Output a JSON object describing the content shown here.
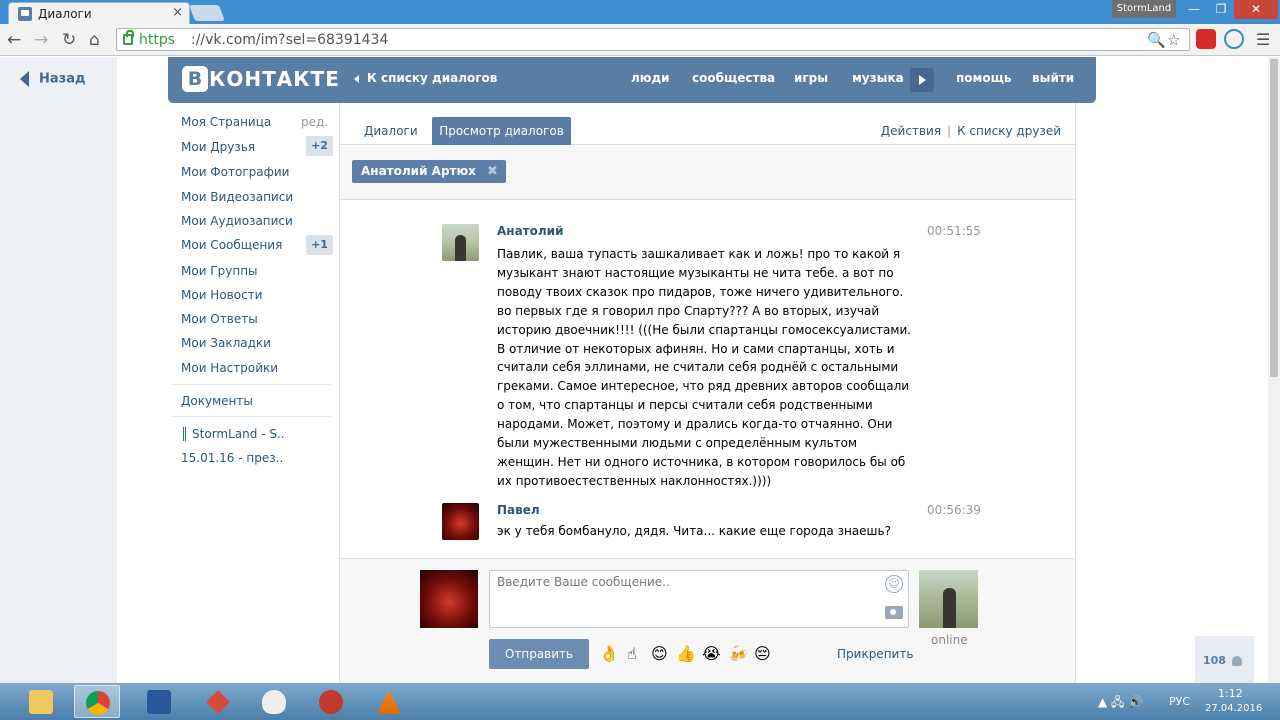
{
  "browser": {
    "tab_title": "Диалоги",
    "tab_close": "×",
    "profile_name": "StormLand",
    "url_https": "https",
    "url_rest": "://vk.com/im?sel=68391434",
    "window_controls": {
      "minimize": "—",
      "maximize": "❐",
      "close": "✕"
    }
  },
  "page": {
    "back_label": "Назад",
    "logo_b": "В",
    "logo_text": "КОНТАКТЕ",
    "header": {
      "back_to_dialogs": "К списку диалогов",
      "links": [
        "люди",
        "сообщества",
        "игры",
        "музыка",
        "помощь",
        "выйти"
      ]
    },
    "sidebar": {
      "items": [
        {
          "label": "Моя Страница",
          "extra": "ред."
        },
        {
          "label": "Мои Друзья",
          "badge": "+2"
        },
        {
          "label": "Мои Фотографии"
        },
        {
          "label": "Мои Видеозаписи"
        },
        {
          "label": "Мои Аудиозаписи"
        },
        {
          "label": "Мои Сообщения",
          "badge": "+1"
        },
        {
          "label": "Мои Группы"
        },
        {
          "label": "Мои Новости"
        },
        {
          "label": "Мои Ответы"
        },
        {
          "label": "Мои Закладки"
        },
        {
          "label": "Мои Настройки"
        }
      ],
      "documents": "Документы",
      "extra_links": [
        "║ StormLand - S..",
        "15.01.16 - през.."
      ]
    },
    "tabs": {
      "dialogs": "Диалоги",
      "view": "Просмотр диалогов",
      "actions": "Действия",
      "separator": "|",
      "friends": "К списку друзей"
    },
    "peer_chip": {
      "name": "Анатолий Артюх",
      "remove": "✖"
    },
    "messages": [
      {
        "author": "Анатолий",
        "time": "00:51:55",
        "text": "Павлик, ваша тупасть зашкаливает как и ложь! про то какой я музыкант знают настоящие музыканты не чита тебе. а вот по поводу твоих сказок про пидаров, тоже ничего удивительного. во первых где я говорил про Спарту??? А во вторых, изучай историю двоечник!!!! (((Не были спартанцы гомосексуалистами. В отличие от некоторых афинян. Но и сами спартанцы, хоть и считали себя эллинами, не считали себя роднёй с остальными греками. Самое интересное, что ряд древних авторов сообщали о том, что спартанцы и персы считали себя родственными народами. Может, поэтому и дрались когда-то отчаянно. Они были мужественными людьми с определённым культом женщин. Нет ни одного источника, в котором говорилось бы об их противоестественных наклонностях.))))"
      },
      {
        "author": "Павел",
        "time": "00:56:39",
        "text": "эк у тебя бомбануло, дядя. Чита... какие еще города знаешь?"
      }
    ],
    "compose": {
      "placeholder": "Введите Ваше сообщение..",
      "send": "Отправить",
      "online": "online",
      "attach": "Прикрепить",
      "emojis": [
        "👌",
        "☝",
        "😊",
        "👍",
        "😭",
        "🍻",
        "😔"
      ]
    },
    "counter": "108"
  },
  "taskbar": {
    "lang": "РУС",
    "time": "1:12",
    "date": "27.04.2016",
    "tray_icons": "▲ 🖧 🔊"
  }
}
